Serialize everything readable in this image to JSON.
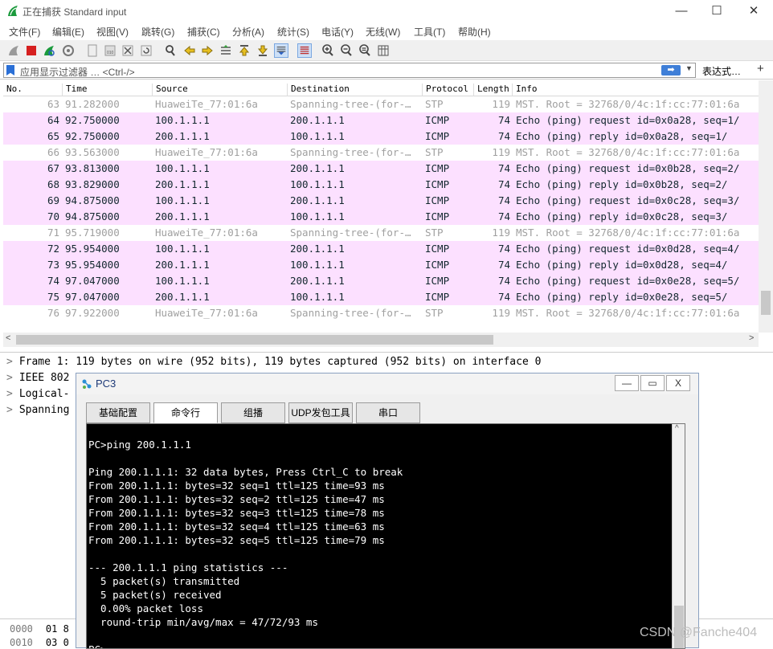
{
  "window": {
    "title": "正在捕获 Standard input",
    "minimize": "—",
    "maximize": "☐",
    "close": "✕"
  },
  "menu": [
    "文件(F)",
    "编辑(E)",
    "视图(V)",
    "跳转(G)",
    "捕获(C)",
    "分析(A)",
    "统计(S)",
    "电话(Y)",
    "无线(W)",
    "工具(T)",
    "帮助(H)"
  ],
  "filter": {
    "placeholder": "应用显示过滤器 … <Ctrl-/>",
    "apply": "➡",
    "dropdown": "▼",
    "expression": "表达式…",
    "add": "+"
  },
  "columns": [
    "No.",
    "Time",
    "Source",
    "Destination",
    "Protocol",
    "Length",
    "Info"
  ],
  "packets": [
    {
      "no": "63",
      "time": "91.282000",
      "src": "HuaweiTe_77:01:6a",
      "dst": "Spanning-tree-(for-…",
      "proto": "STP",
      "len": "119",
      "info": "MST. Root = 32768/0/4c:1f:cc:77:01:6a",
      "kind": "stp"
    },
    {
      "no": "64",
      "time": "92.750000",
      "src": "100.1.1.1",
      "dst": "200.1.1.1",
      "proto": "ICMP",
      "len": "74",
      "info": "Echo (ping) request  id=0x0a28, seq=1/",
      "kind": "icmp"
    },
    {
      "no": "65",
      "time": "92.750000",
      "src": "200.1.1.1",
      "dst": "100.1.1.1",
      "proto": "ICMP",
      "len": "74",
      "info": "Echo (ping) reply    id=0x0a28, seq=1/",
      "kind": "icmp"
    },
    {
      "no": "66",
      "time": "93.563000",
      "src": "HuaweiTe_77:01:6a",
      "dst": "Spanning-tree-(for-…",
      "proto": "STP",
      "len": "119",
      "info": "MST. Root = 32768/0/4c:1f:cc:77:01:6a",
      "kind": "stp"
    },
    {
      "no": "67",
      "time": "93.813000",
      "src": "100.1.1.1",
      "dst": "200.1.1.1",
      "proto": "ICMP",
      "len": "74",
      "info": "Echo (ping) request  id=0x0b28, seq=2/",
      "kind": "icmp"
    },
    {
      "no": "68",
      "time": "93.829000",
      "src": "200.1.1.1",
      "dst": "100.1.1.1",
      "proto": "ICMP",
      "len": "74",
      "info": "Echo (ping) reply    id=0x0b28, seq=2/",
      "kind": "icmp"
    },
    {
      "no": "69",
      "time": "94.875000",
      "src": "100.1.1.1",
      "dst": "200.1.1.1",
      "proto": "ICMP",
      "len": "74",
      "info": "Echo (ping) request  id=0x0c28, seq=3/",
      "kind": "icmp"
    },
    {
      "no": "70",
      "time": "94.875000",
      "src": "200.1.1.1",
      "dst": "100.1.1.1",
      "proto": "ICMP",
      "len": "74",
      "info": "Echo (ping) reply    id=0x0c28, seq=3/",
      "kind": "icmp"
    },
    {
      "no": "71",
      "time": "95.719000",
      "src": "HuaweiTe_77:01:6a",
      "dst": "Spanning-tree-(for-…",
      "proto": "STP",
      "len": "119",
      "info": "MST. Root = 32768/0/4c:1f:cc:77:01:6a",
      "kind": "stp"
    },
    {
      "no": "72",
      "time": "95.954000",
      "src": "100.1.1.1",
      "dst": "200.1.1.1",
      "proto": "ICMP",
      "len": "74",
      "info": "Echo (ping) request  id=0x0d28, seq=4/",
      "kind": "icmp"
    },
    {
      "no": "73",
      "time": "95.954000",
      "src": "200.1.1.1",
      "dst": "100.1.1.1",
      "proto": "ICMP",
      "len": "74",
      "info": "Echo (ping) reply    id=0x0d28, seq=4/",
      "kind": "icmp"
    },
    {
      "no": "74",
      "time": "97.047000",
      "src": "100.1.1.1",
      "dst": "200.1.1.1",
      "proto": "ICMP",
      "len": "74",
      "info": "Echo (ping) request  id=0x0e28, seq=5/",
      "kind": "icmp"
    },
    {
      "no": "75",
      "time": "97.047000",
      "src": "200.1.1.1",
      "dst": "100.1.1.1",
      "proto": "ICMP",
      "len": "74",
      "info": "Echo (ping) reply    id=0x0e28, seq=5/",
      "kind": "icmp"
    },
    {
      "no": "76",
      "time": "97.922000",
      "src": "HuaweiTe_77:01:6a",
      "dst": "Spanning-tree-(for-…",
      "proto": "STP",
      "len": "119",
      "info": "MST. Root = 32768/0/4c:1f:cc:77:01:6a",
      "kind": "stp"
    }
  ],
  "details": [
    "Frame 1: 119 bytes on wire (952 bits), 119 bytes captured (952 bits) on interface 0",
    "IEEE 802",
    "Logical-",
    "Spanning"
  ],
  "hex": [
    {
      "offset": "0000",
      "bytes": "01 8"
    },
    {
      "offset": "0010",
      "bytes": "03 0"
    }
  ],
  "pc3": {
    "title": "PC3",
    "tabs": [
      "基础配置",
      "命令行",
      "组播",
      "UDP发包工具",
      "串口"
    ],
    "active_tab": "命令行",
    "terminal": "PC>ping 200.1.1.1\n\nPing 200.1.1.1: 32 data bytes, Press Ctrl_C to break\nFrom 200.1.1.1: bytes=32 seq=1 ttl=125 time=93 ms\nFrom 200.1.1.1: bytes=32 seq=2 ttl=125 time=47 ms\nFrom 200.1.1.1: bytes=32 seq=3 ttl=125 time=78 ms\nFrom 200.1.1.1: bytes=32 seq=4 ttl=125 time=63 ms\nFrom 200.1.1.1: bytes=32 seq=5 ttl=125 time=79 ms\n\n--- 200.1.1.1 ping statistics ---\n  5 packet(s) transmitted\n  5 packet(s) received\n  0.00% packet loss\n  round-trip min/avg/max = 47/72/93 ms\n\nPC>"
  },
  "watermark": "CSDN @Fanche404",
  "colors": {
    "icmp_row": "#fce0ff",
    "stp_text": "#a0a0a0",
    "terminal_bg": "#000000"
  }
}
